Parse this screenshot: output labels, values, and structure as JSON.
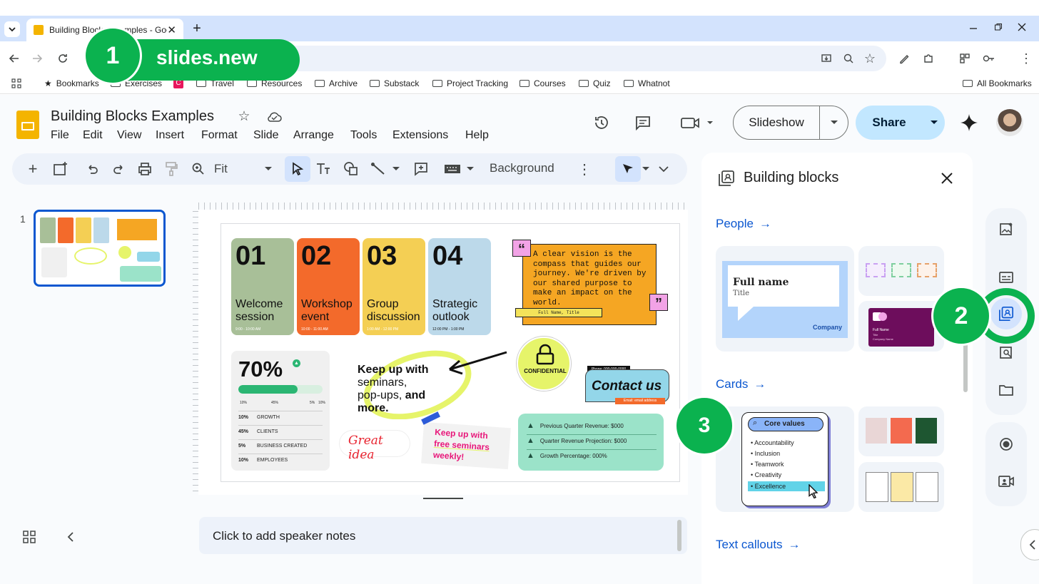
{
  "browser": {
    "tab_title": "Building Blocks Examples - Goo",
    "url_overlay": "slides.new",
    "bookmarks": [
      "Bookmarks",
      "Exercises",
      "Travel",
      "Resources",
      "Archive",
      "Substack",
      "Project Tracking",
      "Courses",
      "Quiz",
      "Whatnot"
    ],
    "all_bookmarks": "All Bookmarks"
  },
  "doc": {
    "title": "Building Blocks Examples",
    "menu": [
      "File",
      "Edit",
      "View",
      "Insert",
      "Format",
      "Slide",
      "Arrange",
      "Tools",
      "Extensions",
      "Help"
    ],
    "slideshow": "Slideshow",
    "share": "Share"
  },
  "toolbar": {
    "zoom": "Fit",
    "background": "Background"
  },
  "filmstrip": {
    "slide_number": "1"
  },
  "speaker_notes": "Click to add speaker notes",
  "slide": {
    "agenda": [
      {
        "num": "01",
        "label": "Welcome session",
        "time": "9:00 - 10:00 AM",
        "color": "#a8bf98"
      },
      {
        "num": "02",
        "label": "Workshop event",
        "time": "10:00 - 11:00 AM",
        "color": "#f36a2b"
      },
      {
        "num": "03",
        "label": "Group discussion",
        "time": "1:00 AM - 12:00 PM",
        "color": "#f4cf54"
      },
      {
        "num": "04",
        "label": "Strategic outlook",
        "time": "12:00 PM - 1:00 PM",
        "color": "#bcd9ea"
      }
    ],
    "quote": "A clear vision is the compass that guides our journey. We're driven by our shared purpose to make an impact on the world.",
    "quote_author": "Full Name, Title",
    "stat_big": "70%",
    "progress_fraction": 0.7,
    "scale_labels": [
      "10%",
      "45%",
      "5%",
      "10%"
    ],
    "stats": [
      {
        "pct": "10%",
        "label": "GROWTH"
      },
      {
        "pct": "45%",
        "label": "CLIENTS"
      },
      {
        "pct": "5%",
        "label": "BUSINESS CREATED"
      },
      {
        "pct": "10%",
        "label": "EMPLOYEES"
      }
    ],
    "keep_up_lines": [
      "Keep up with",
      "seminars,",
      "pop-ups,"
    ],
    "keep_up_and": "and",
    "keep_up_more": "more.",
    "confidential": "CONFIDENTIAL",
    "contact_phone": "Phone: 000-000-0000",
    "contact": "Contact us",
    "contact_email": "Email: email address",
    "great_idea": "Great idea",
    "seminar_note": [
      "Keep up with",
      "free seminars",
      "weekly!"
    ],
    "revenue": [
      "Previous Quarter Revenue: $000",
      "Quarter Revenue Projection: $000",
      "Growth Percentage: 000%"
    ]
  },
  "panel": {
    "title": "Building blocks",
    "sections": [
      "People",
      "Cards",
      "Text callouts"
    ],
    "people_card": {
      "name": "Full name",
      "title": "Title",
      "company": "Company"
    },
    "people_card2": {
      "name": "Full Name",
      "title": "Title",
      "company": "Company Name"
    },
    "core_values_title": "Core values",
    "core_values": [
      "Accountability",
      "Inclusion",
      "Teamwork",
      "Creativity",
      "Excellence"
    ]
  },
  "badges": [
    "1",
    "2",
    "3"
  ],
  "colors": {
    "accent": "#0b57d0",
    "badge": "#0bb24f",
    "share_bg": "#c2e7ff",
    "people_blue": "#b3d4fb",
    "purple": "#6d0d5c",
    "revenue_bg": "#9be3c9",
    "contact_bg": "#93d6e9",
    "yellow_green": "#e6f46a"
  }
}
